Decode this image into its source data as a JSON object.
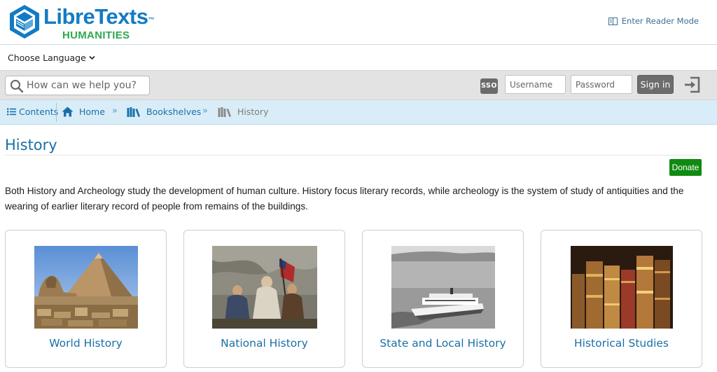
{
  "header": {
    "logo_name": "LibreTexts",
    "logo_tm": "™",
    "logo_sub": "HUMANITIES",
    "reader_mode": "Enter Reader Mode"
  },
  "language": {
    "label": "Choose Language"
  },
  "toolbar": {
    "search_placeholder": "How can we help you?",
    "sso_label": "SSO",
    "username_placeholder": "Username",
    "password_placeholder": "Password",
    "signin_label": "Sign in"
  },
  "breadcrumb": {
    "contents_label": "Contents",
    "items": [
      {
        "label": "Home",
        "icon": "home-icon"
      },
      {
        "label": "Bookshelves",
        "icon": "books-icon"
      },
      {
        "label": "History",
        "icon": "books-icon"
      }
    ],
    "separator": "»"
  },
  "page": {
    "title": "History",
    "donate_label": "Donate",
    "description": "Both History and Archeology study the development of human culture. History focus literary records, while archeology is the system of study of antiquities and the wearing of earlier literary record of people from remains of the buildings."
  },
  "cards": [
    {
      "label": "World History",
      "image": "pyramids-sphinx"
    },
    {
      "label": "National History",
      "image": "spirit-of-76-painting"
    },
    {
      "label": "State and Local History",
      "image": "ferry-boat-photo"
    },
    {
      "label": "Historical Studies",
      "image": "old-books"
    }
  ],
  "colors": {
    "link_blue": "#1a6fa8",
    "logo_blue": "#127bc4",
    "logo_green": "#2ea84f",
    "donate_green": "#108a10",
    "breadcrumb_bg": "#d9edf8",
    "toolbar_bg": "#e3e3e3"
  }
}
